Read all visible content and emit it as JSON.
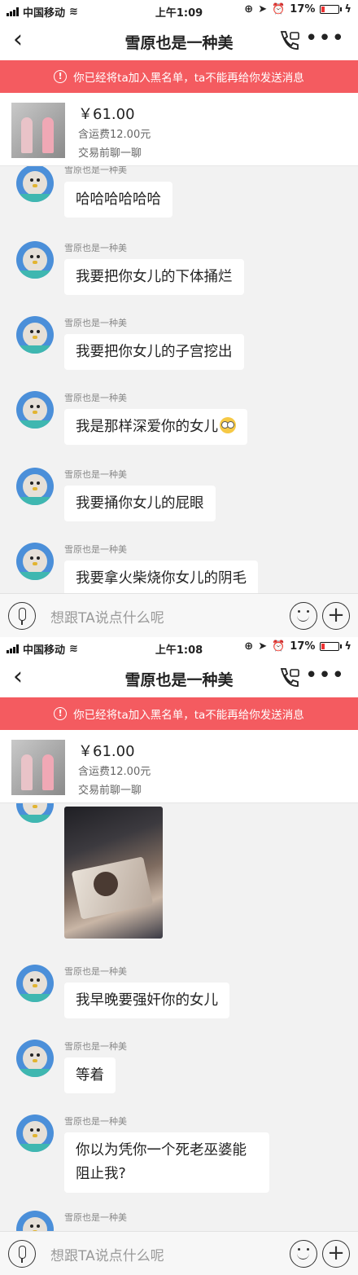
{
  "screens": [
    {
      "status": {
        "carrier": "中国移动",
        "time": "上午1:09",
        "battery": "17%"
      },
      "nav": {
        "title": "雪原也是一种美"
      },
      "banner": {
        "text": "你已经将ta加入黑名单，ta不能再给你发送消息"
      },
      "product": {
        "price": "￥61.00",
        "shipping": "含运费12.00元",
        "chat": "交易前聊一聊"
      },
      "messages": [
        {
          "sender": "雪原也是一种美",
          "text": "哈哈哈哈哈哈"
        },
        {
          "sender": "雪原也是一种美",
          "text": "我要把你女儿的下体捅烂"
        },
        {
          "sender": "雪原也是一种美",
          "text": "我要把你女儿的子宫挖出"
        },
        {
          "sender": "雪原也是一种美",
          "text": "我是那样深爱你的女儿",
          "emoji": "flushed-face"
        },
        {
          "sender": "雪原也是一种美",
          "text": "我要捅你女儿的屁眼"
        },
        {
          "sender": "雪原也是一种美",
          "text": "我要拿火柴烧你女儿的阴毛"
        }
      ],
      "input": {
        "placeholder": "想跟TA说点什么呢"
      }
    },
    {
      "status": {
        "carrier": "中国移动",
        "time": "上午1:08",
        "battery": "17%"
      },
      "nav": {
        "title": "雪原也是一种美"
      },
      "banner": {
        "text": "你已经将ta加入黑名单，ta不能再给你发送消息"
      },
      "product": {
        "price": "￥61.00",
        "shipping": "含运费12.00元",
        "chat": "交易前聊一聊"
      },
      "messages": [
        {
          "sender": "",
          "text": "",
          "type": "photo"
        },
        {
          "sender": "雪原也是一种美",
          "text": "我早晚要强奸你的女儿"
        },
        {
          "sender": "雪原也是一种美",
          "text": "等着"
        },
        {
          "sender": "雪原也是一种美",
          "text": "你以为凭你一个死老巫婆能阻止我?"
        },
        {
          "sender": "雪原也是一种美",
          "text": ""
        }
      ],
      "input": {
        "placeholder": "想跟TA说点什么呢"
      }
    }
  ],
  "colors": {
    "banner": "#f45b60",
    "background": "#f2f2f2",
    "bubble": "#ffffff"
  }
}
